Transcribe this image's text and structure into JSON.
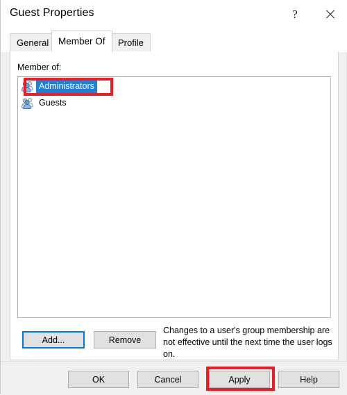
{
  "window": {
    "title": "Guest Properties",
    "help_icon": "question-mark-icon",
    "close_icon": "close-icon"
  },
  "tabs": [
    {
      "label": "General",
      "selected": false
    },
    {
      "label": "Member Of",
      "selected": true
    },
    {
      "label": "Profile",
      "selected": false
    }
  ],
  "main": {
    "list_label": "Member of:",
    "groups": [
      {
        "name": "Administrators",
        "selected": true,
        "icon": "user-group-icon"
      },
      {
        "name": "Guests",
        "selected": false,
        "icon": "user-group-icon"
      }
    ],
    "add_label": "Add...",
    "remove_label": "Remove",
    "description": "Changes to a user's group membership are not effective until the next time the user logs on."
  },
  "footer": {
    "ok_label": "OK",
    "cancel_label": "Cancel",
    "apply_label": "Apply",
    "help_label": "Help"
  },
  "annotations": {
    "accent_color": "#ee1c25",
    "highlighted": [
      "Administrators",
      "Apply"
    ]
  },
  "colors": {
    "selection_blue": "#1f7fd4",
    "focus_blue": "#0078d7",
    "dialog_bg": "#f0f0f0",
    "annotation_red": "#ee1c25"
  }
}
